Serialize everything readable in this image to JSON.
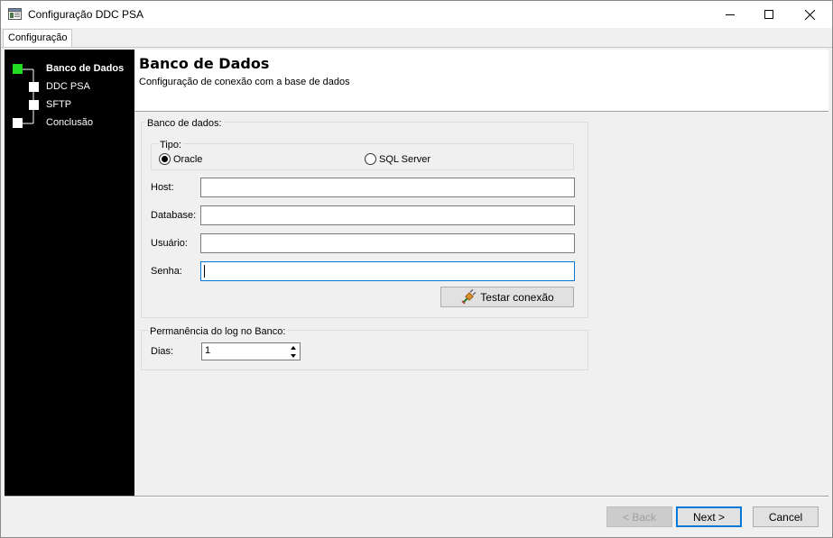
{
  "window": {
    "title": "Configuração DDC PSA"
  },
  "tabs": [
    {
      "label": "Configuração"
    }
  ],
  "steps": [
    {
      "label": "Banco de Dados",
      "active": true,
      "color": "#22dd22"
    },
    {
      "label": "DDC PSA",
      "active": false,
      "color": "#ffffff"
    },
    {
      "label": "SFTP",
      "active": false,
      "color": "#ffffff"
    },
    {
      "label": "Conclusão",
      "active": false,
      "color": "#ffffff"
    }
  ],
  "header": {
    "title": "Banco de Dados",
    "subtitle": "Configuração de conexão com a base de dados"
  },
  "database_group": {
    "legend": "Banco de dados:",
    "type_group": {
      "legend": "Tipo:",
      "options": [
        {
          "label": "Oracle",
          "selected": true
        },
        {
          "label": "SQL Server",
          "selected": false
        }
      ]
    },
    "fields": {
      "host": {
        "label": "Host:",
        "value": ""
      },
      "database": {
        "label": "Database:",
        "value": ""
      },
      "usuario": {
        "label": "Usuário:",
        "value": ""
      },
      "senha": {
        "label": "Senha:",
        "value": ""
      }
    },
    "test_button": {
      "label": "Testar conexão",
      "icon": "plug-icon"
    }
  },
  "log_group": {
    "legend": "Permanência do log no Banco:",
    "dias": {
      "label": "Dias:",
      "value": "1"
    }
  },
  "footer": {
    "back_label": "< Back",
    "next_label": "Next >",
    "cancel_label": "Cancel"
  },
  "colors": {
    "accent": "#0078d7",
    "sidebar_bg": "#000000",
    "active_step": "#22dd22"
  }
}
